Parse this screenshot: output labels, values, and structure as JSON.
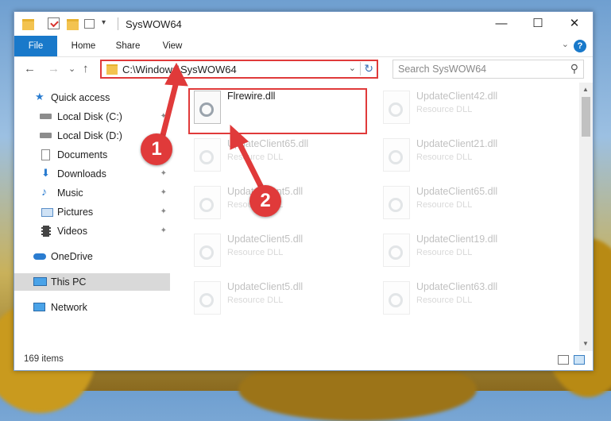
{
  "window": {
    "title": "SysWOW64",
    "minimize_glyph": "—",
    "maximize_glyph": "☐",
    "close_glyph": "✕"
  },
  "ribbon": {
    "tabs": [
      "File",
      "Home",
      "Share",
      "View"
    ],
    "help_glyph": "?",
    "collapse_glyph": "⌄"
  },
  "nav": {
    "back_glyph": "←",
    "forward_glyph": "→",
    "recent_glyph": "⌄",
    "up_glyph": "↑",
    "address": "C:\\Windows\\SysWOW64",
    "address_dropdown_glyph": "⌄",
    "refresh_glyph": "↻",
    "search_placeholder": "Search SysWOW64",
    "search_glyph": "⚲"
  },
  "sidebar": {
    "items": [
      {
        "label": "Quick access",
        "icon": "star-icon"
      },
      {
        "label": "Local Disk (C:)",
        "icon": "drive-icon",
        "pinned": true
      },
      {
        "label": "Local Disk (D:)",
        "icon": "drive-icon",
        "pinned": true
      },
      {
        "label": "Documents",
        "icon": "documents-icon",
        "pinned": true
      },
      {
        "label": "Downloads",
        "icon": "download-icon",
        "pinned": true
      },
      {
        "label": "Music",
        "icon": "music-icon",
        "pinned": true
      },
      {
        "label": "Pictures",
        "icon": "pictures-icon",
        "pinned": true
      },
      {
        "label": "Videos",
        "icon": "videos-icon",
        "pinned": true
      },
      {
        "label": "OneDrive",
        "icon": "cloud-icon"
      },
      {
        "label": "This PC",
        "icon": "computer-icon",
        "selected": true
      },
      {
        "label": "Network",
        "icon": "network-icon"
      }
    ],
    "pin_glyph": "📌"
  },
  "files": [
    {
      "name": "Flrewire.dll",
      "type": "",
      "highlighted": true
    },
    {
      "name": "UpdateClient42.dll",
      "type": "Resource DLL"
    },
    {
      "name": "UpdateClient65.dll",
      "type": "Resource DLL"
    },
    {
      "name": "UpdateClient21.dll",
      "type": "Resource DLL"
    },
    {
      "name": "UpdateClient5.dll",
      "type": "Resource DLL"
    },
    {
      "name": "UpdateClient65.dll",
      "type": "Resource DLL"
    },
    {
      "name": "UpdateClient5.dll",
      "type": "Resource DLL"
    },
    {
      "name": "UpdateClient19.dll",
      "type": "Resource DLL"
    },
    {
      "name": "UpdateClient5.dll",
      "type": "Resource DLL"
    },
    {
      "name": "UpdateClient63.dll",
      "type": "Resource DLL"
    }
  ],
  "status": {
    "item_count": "169 items"
  },
  "annotations": {
    "step1": "1",
    "step2": "2",
    "accent_color": "#e03a3a"
  },
  "scroll": {
    "up_glyph": "▲",
    "down_glyph": "▼"
  }
}
